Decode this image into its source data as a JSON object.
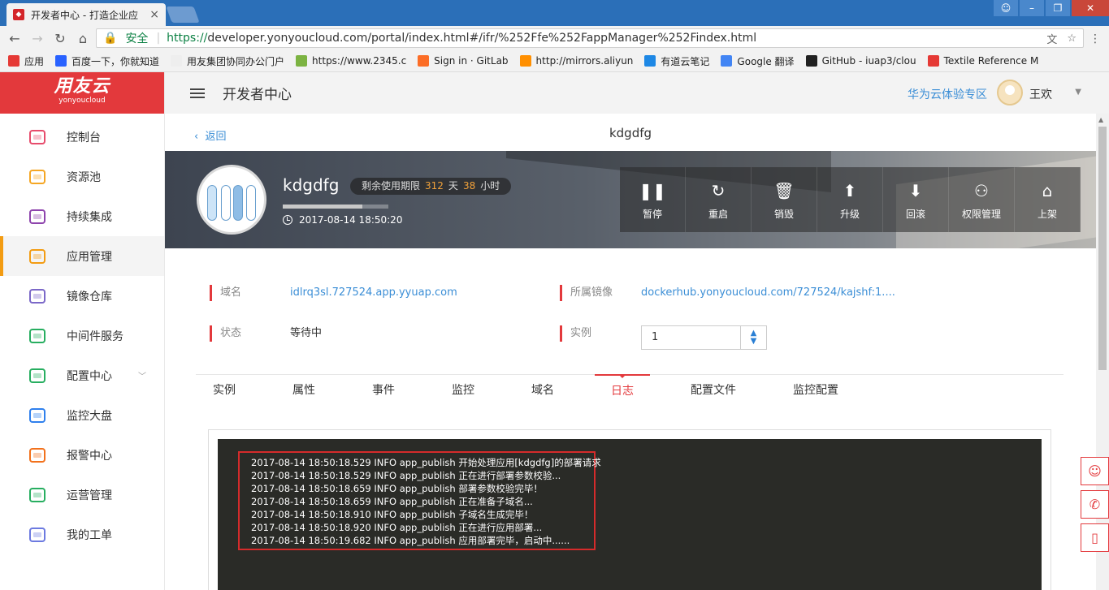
{
  "browser": {
    "tab_title": "开发者中心 - 打造企业应",
    "tab_close": "×",
    "secure_label": "安全",
    "url_proto": "https://",
    "url_rest": "developer.yonyoucloud.com/portal/index.html#/ifr/%252Ffe%252FappManager%252Findex.html",
    "bookmarks": [
      {
        "label": "应用",
        "color": "#e53935"
      },
      {
        "label": "百度一下，你就知道",
        "color": "#2962ff"
      },
      {
        "label": "用友集团协同办公门户",
        "color": "#eeeeee"
      },
      {
        "label": "https://www.2345.c",
        "color": "#7cb342"
      },
      {
        "label": "Sign in · GitLab",
        "color": "#fc6d26"
      },
      {
        "label": "http://mirrors.aliyun",
        "color": "#ff8f00"
      },
      {
        "label": "有道云笔记",
        "color": "#1e88e5"
      },
      {
        "label": "Google 翻译",
        "color": "#4285f4"
      },
      {
        "label": "GitHub - iuap3/clou",
        "color": "#212121"
      },
      {
        "label": "Textile Reference M",
        "color": "#e53935"
      }
    ]
  },
  "sidebar": {
    "logo_cn": "用友云",
    "logo_en": "yonyoucloud",
    "items": [
      {
        "label": "控制台",
        "icon": "dashboard-icon",
        "color": "#e74c6c"
      },
      {
        "label": "资源池",
        "icon": "inbox-icon",
        "color": "#f5a623"
      },
      {
        "label": "持续集成",
        "icon": "integration-icon",
        "color": "#8e44ad"
      },
      {
        "label": "应用管理",
        "icon": "cubes-icon",
        "color": "#f39c12"
      },
      {
        "label": "镜像仓库",
        "icon": "warehouse-icon",
        "color": "#7b68c8"
      },
      {
        "label": "中间件服务",
        "icon": "database-icon",
        "color": "#27ae60"
      },
      {
        "label": "配置中心",
        "icon": "tools-icon",
        "color": "#27ae60"
      },
      {
        "label": "监控大盘",
        "icon": "monitor-icon",
        "color": "#2f80ed"
      },
      {
        "label": "报警中心",
        "icon": "bell-icon",
        "color": "#f2711c"
      },
      {
        "label": "运营管理",
        "icon": "chart-screen-icon",
        "color": "#27ae60"
      },
      {
        "label": "我的工单",
        "icon": "document-icon",
        "color": "#6c7ae0"
      }
    ]
  },
  "topbar": {
    "title": "开发者中心",
    "link": "华为云体验专区",
    "user_name": "王欢"
  },
  "page": {
    "back_label": "返回",
    "title": "kdgdfg"
  },
  "app": {
    "name": "kdgdfg",
    "remain_label": "剩余使用期限",
    "remain_days": "312",
    "days_unit": "天",
    "remain_hours": "38",
    "hours_unit": "小时",
    "created_at": "2017-08-14 18:50:20",
    "usage_fraction": 0.75
  },
  "actions": [
    {
      "label": "暂停",
      "icon": "pause-icon",
      "glyph": "❚❚"
    },
    {
      "label": "重启",
      "icon": "restart-icon",
      "glyph": "↻"
    },
    {
      "label": "销毁",
      "icon": "trash-icon",
      "glyph": "🗑"
    },
    {
      "label": "升级",
      "icon": "upgrade-icon",
      "glyph": "⬆"
    },
    {
      "label": "回滚",
      "icon": "rollback-icon",
      "glyph": "⬇"
    },
    {
      "label": "权限管理",
      "icon": "user-permission-icon",
      "glyph": "⚇"
    },
    {
      "label": "上架",
      "icon": "store-icon",
      "glyph": "⌂"
    }
  ],
  "info": {
    "domain_label": "域名",
    "domain_value": "idlrq3sl.727524.app.yyuap.com",
    "image_label": "所属镜像",
    "image_value": "dockerhub.yonyoucloud.com/727524/kajshf:1....",
    "status_label": "状态",
    "status_value": "等待中",
    "instance_label": "实例",
    "instance_value": "1"
  },
  "tabs": [
    "实例",
    "属性",
    "事件",
    "监控",
    "域名",
    "日志",
    "配置文件",
    "监控配置"
  ],
  "active_tab": "日志",
  "logs": [
    "2017-08-14 18:50:18.529 INFO app_publish 开始处理应用[kdgdfg]的部署请求",
    "2017-08-14 18:50:18.529 INFO app_publish 正在进行部署参数校验...",
    "2017-08-14 18:50:18.659 INFO app_publish 部署参数校验完毕！",
    "2017-08-14 18:50:18.659 INFO app_publish 正在准备子域名...",
    "2017-08-14 18:50:18.910 INFO app_publish 子域名生成完毕！",
    "2017-08-14 18:50:18.920 INFO app_publish 正在进行应用部署...",
    "2017-08-14 18:50:19.682 INFO app_publish 应用部署完毕，启动中......"
  ],
  "colors": {
    "brand": "#e3393c",
    "link": "#3b8ed6",
    "accent": "#f39c12"
  }
}
